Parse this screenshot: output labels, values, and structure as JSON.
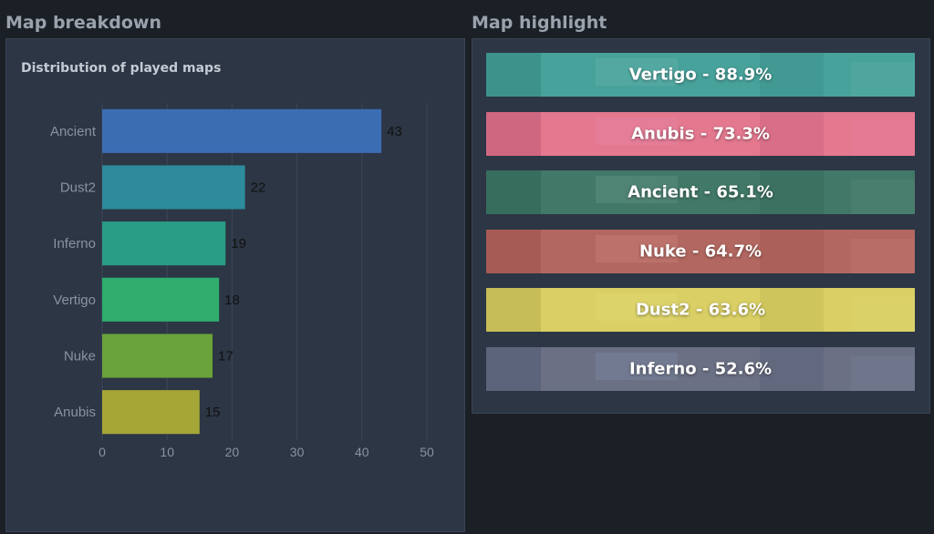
{
  "sections": {
    "left_title": "Map breakdown",
    "right_title": "Map highlight"
  },
  "chart_data": {
    "type": "bar",
    "orientation": "horizontal",
    "title": "Distribution of played maps",
    "categories": [
      "Ancient",
      "Dust2",
      "Inferno",
      "Vertigo",
      "Nuke",
      "Anubis"
    ],
    "values": [
      43,
      22,
      19,
      18,
      17,
      15
    ],
    "colors": [
      "#3b6db3",
      "#2e8b9b",
      "#2a9d85",
      "#2fae6e",
      "#6aa33a",
      "#a5a636"
    ],
    "xlim": [
      0,
      50
    ],
    "xticks": [
      0,
      10,
      20,
      30,
      40,
      50
    ],
    "grid": true,
    "xlabel": "",
    "ylabel": ""
  },
  "highlights": [
    {
      "label": "Vertigo - 88.9%",
      "tint": "#0f8f7a",
      "base": "#8fb8c6"
    },
    {
      "label": "Anubis - 73.3%",
      "tint": "#e0357e",
      "base": "#e6c9a4"
    },
    {
      "label": "Ancient - 65.1%",
      "tint": "#1f6a58",
      "base": "#6a8a7a"
    },
    {
      "label": "Nuke - 64.7%",
      "tint": "#c7382c",
      "base": "#9aa3a3"
    },
    {
      "label": "Dust2 - 63.6%",
      "tint": "#d8cc1a",
      "base": "#d9d2c2"
    },
    {
      "label": "Inferno - 52.6%",
      "tint": "#2b4f8c",
      "base": "#b89a7a"
    }
  ]
}
